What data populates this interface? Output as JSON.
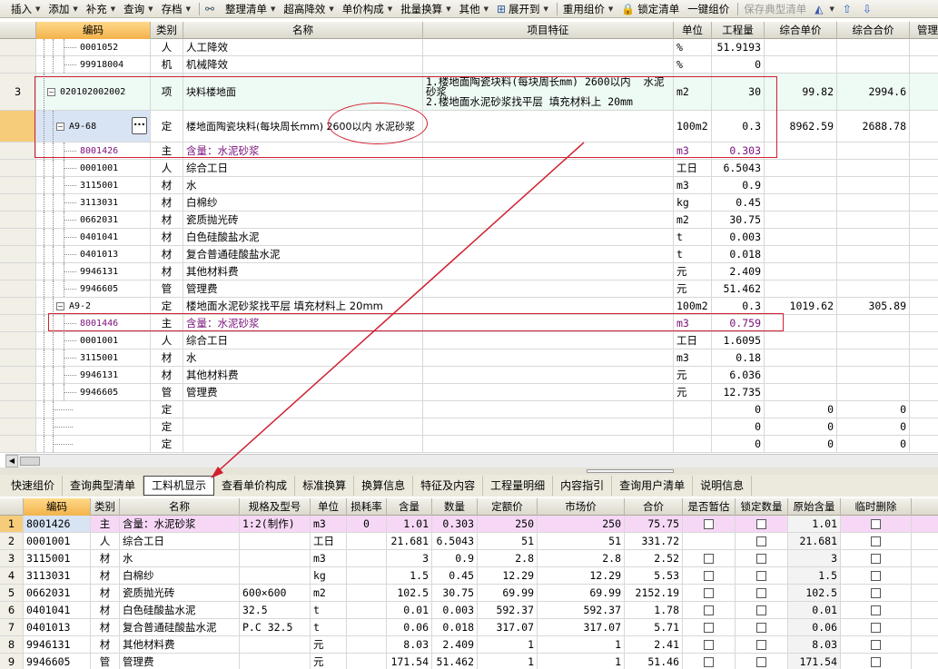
{
  "toolbar": [
    {
      "label": "插入",
      "dd": true
    },
    {
      "label": "添加",
      "dd": true
    },
    {
      "label": "补充",
      "dd": true
    },
    {
      "label": "查询",
      "dd": true
    },
    {
      "label": "存档",
      "dd": true
    },
    {
      "label": "",
      "icon": "binoculars-icon",
      "dd": false
    },
    {
      "label": "整理清单",
      "dd": true
    },
    {
      "label": "超高降效",
      "dd": true
    },
    {
      "label": "单价构成",
      "dd": true
    },
    {
      "label": "批量换算",
      "dd": true
    },
    {
      "label": "其他",
      "dd": true
    },
    {
      "label": "展开到",
      "icon": "tree-icon",
      "dd": true
    },
    {
      "label": "重用组价",
      "dd": true
    },
    {
      "label": "锁定清单",
      "icon": "lock-icon",
      "dd": false
    },
    {
      "label": "一键组价",
      "dd": false
    },
    {
      "label": "保存典型清单",
      "dd": false,
      "disabled": true
    },
    {
      "label": "",
      "icon": "paint-bucket-icon",
      "dd": true
    },
    {
      "label": "",
      "icon": "arrow-up-icon",
      "dd": false
    },
    {
      "label": "",
      "icon": "arrow-down-icon",
      "dd": false
    }
  ],
  "grid1": {
    "headers": [
      "编码",
      "类别",
      "名称",
      "项目特征",
      "单位",
      "工程量",
      "综合单价",
      "综合合价",
      "管理"
    ],
    "rows": [
      {
        "num": "",
        "code": "0001052",
        "type": "人",
        "name": "人工降效",
        "feature": "",
        "unit": "%",
        "qty": "51.9193",
        "uprice": "",
        "total": "",
        "level": 2
      },
      {
        "num": "",
        "code": "99918004",
        "type": "机",
        "name": "机械降效",
        "feature": "",
        "unit": "%",
        "qty": "0",
        "uprice": "",
        "total": "",
        "level": 2
      },
      {
        "num": "3",
        "code": "020102002002",
        "type": "项",
        "name": "块料楼地面",
        "feature": "1.楼地面陶瓷块料(每块周长mm) 2600以内  水泥砂浆\n2.楼地面水泥砂浆找平层 填充材料上 20mm",
        "unit": "m2",
        "qty": "30",
        "uprice": "99.82",
        "total": "2994.6",
        "level": 0,
        "tall": true
      },
      {
        "num": "",
        "code": "A9-68",
        "type": "定",
        "name": "楼地面陶瓷块料(每块周长mm) 2600以内  水泥砂浆",
        "feature": "",
        "unit": "100m2",
        "qty": "0.3",
        "uprice": "8962.59",
        "total": "2688.78",
        "level": 1,
        "tall": true,
        "selected": true
      },
      {
        "num": "",
        "code": "8001426",
        "type": "主",
        "name": "含量：水泥砂浆",
        "feature": "",
        "unit": "m3",
        "qty": "0.303",
        "uprice": "",
        "total": "",
        "level": 2,
        "purple": true
      },
      {
        "num": "",
        "code": "0001001",
        "type": "人",
        "name": "综合工日",
        "feature": "",
        "unit": "工日",
        "qty": "6.5043",
        "uprice": "",
        "total": "",
        "level": 2
      },
      {
        "num": "",
        "code": "3115001",
        "type": "材",
        "name": "水",
        "feature": "",
        "unit": "m3",
        "qty": "0.9",
        "uprice": "",
        "total": "",
        "level": 2
      },
      {
        "num": "",
        "code": "3113031",
        "type": "材",
        "name": "白棉纱",
        "feature": "",
        "unit": "kg",
        "qty": "0.45",
        "uprice": "",
        "total": "",
        "level": 2
      },
      {
        "num": "",
        "code": "0662031",
        "type": "材",
        "name": "瓷质抛光砖",
        "feature": "",
        "unit": "m2",
        "qty": "30.75",
        "uprice": "",
        "total": "",
        "level": 2
      },
      {
        "num": "",
        "code": "0401041",
        "type": "材",
        "name": "白色硅酸盐水泥",
        "feature": "",
        "unit": "t",
        "qty": "0.003",
        "uprice": "",
        "total": "",
        "level": 2
      },
      {
        "num": "",
        "code": "0401013",
        "type": "材",
        "name": "复合普通硅酸盐水泥",
        "feature": "",
        "unit": "t",
        "qty": "0.018",
        "uprice": "",
        "total": "",
        "level": 2
      },
      {
        "num": "",
        "code": "9946131",
        "type": "材",
        "name": "其他材料费",
        "feature": "",
        "unit": "元",
        "qty": "2.409",
        "uprice": "",
        "total": "",
        "level": 2
      },
      {
        "num": "",
        "code": "9946605",
        "type": "管",
        "name": "管理费",
        "feature": "",
        "unit": "元",
        "qty": "51.462",
        "uprice": "",
        "total": "",
        "level": 2
      },
      {
        "num": "",
        "code": "A9-2",
        "type": "定",
        "name": "楼地面水泥砂浆找平层 填充材料上 20mm",
        "feature": "",
        "unit": "100m2",
        "qty": "0.3",
        "uprice": "1019.62",
        "total": "305.89",
        "level": 1
      },
      {
        "num": "",
        "code": "8001446",
        "type": "主",
        "name": "含量：水泥砂浆",
        "feature": "",
        "unit": "m3",
        "qty": "0.759",
        "uprice": "",
        "total": "",
        "level": 2,
        "purple": true
      },
      {
        "num": "",
        "code": "0001001",
        "type": "人",
        "name": "综合工日",
        "feature": "",
        "unit": "工日",
        "qty": "1.6095",
        "uprice": "",
        "total": "",
        "level": 2
      },
      {
        "num": "",
        "code": "3115001",
        "type": "材",
        "name": "水",
        "feature": "",
        "unit": "m3",
        "qty": "0.18",
        "uprice": "",
        "total": "",
        "level": 2
      },
      {
        "num": "",
        "code": "9946131",
        "type": "材",
        "name": "其他材料费",
        "feature": "",
        "unit": "元",
        "qty": "6.036",
        "uprice": "",
        "total": "",
        "level": 2
      },
      {
        "num": "",
        "code": "9946605",
        "type": "管",
        "name": "管理费",
        "feature": "",
        "unit": "元",
        "qty": "12.735",
        "uprice": "",
        "total": "",
        "level": 2
      },
      {
        "num": "",
        "code": "",
        "type": "定",
        "name": "",
        "feature": "",
        "unit": "",
        "qty": "0",
        "uprice": "0",
        "total": "0",
        "level": 1
      },
      {
        "num": "",
        "code": "",
        "type": "定",
        "name": "",
        "feature": "",
        "unit": "",
        "qty": "0",
        "uprice": "0",
        "total": "0",
        "level": 1
      },
      {
        "num": "",
        "code": "",
        "type": "定",
        "name": "",
        "feature": "",
        "unit": "",
        "qty": "0",
        "uprice": "0",
        "total": "0",
        "level": 1
      }
    ]
  },
  "tabs": [
    {
      "label": "快速组价"
    },
    {
      "label": "查询典型清单"
    },
    {
      "label": "工料机显示",
      "active": true
    },
    {
      "label": "查看单价构成"
    },
    {
      "label": "标准换算"
    },
    {
      "label": "换算信息"
    },
    {
      "label": "特征及内容"
    },
    {
      "label": "工程量明细"
    },
    {
      "label": "内容指引"
    },
    {
      "label": "查询用户清单"
    },
    {
      "label": "说明信息"
    }
  ],
  "grid2": {
    "headers": [
      "",
      "编码",
      "类别",
      "名称",
      "规格及型号",
      "单位",
      "损耗率",
      "含量",
      "数量",
      "定额价",
      "市场价",
      "合价",
      "是否暂估",
      "锁定数量",
      "原始含量",
      "临时删除"
    ],
    "rows": [
      {
        "n": "1",
        "code": "8001426",
        "type": "主",
        "name": "含量：水泥砂浆",
        "spec": "1:2(制作)",
        "unit": "m3",
        "loss": "0",
        "content": "1.01",
        "qty": "0.303",
        "quota": "250",
        "market": "250",
        "total": "75.75",
        "est": true,
        "lock": true,
        "orig": "1.01",
        "del": true,
        "highlight": true
      },
      {
        "n": "2",
        "code": "0001001",
        "type": "人",
        "name": "综合工日",
        "spec": "",
        "unit": "工日",
        "loss": "",
        "content": "21.681",
        "qty": "6.5043",
        "quota": "51",
        "market": "51",
        "total": "331.72",
        "est": false,
        "lock": true,
        "orig": "21.681",
        "del": true
      },
      {
        "n": "3",
        "code": "3115001",
        "type": "材",
        "name": "水",
        "spec": "",
        "unit": "m3",
        "loss": "",
        "content": "3",
        "qty": "0.9",
        "quota": "2.8",
        "market": "2.8",
        "total": "2.52",
        "est": true,
        "lock": true,
        "orig": "3",
        "del": true
      },
      {
        "n": "4",
        "code": "3113031",
        "type": "材",
        "name": "白棉纱",
        "spec": "",
        "unit": "kg",
        "loss": "",
        "content": "1.5",
        "qty": "0.45",
        "quota": "12.29",
        "market": "12.29",
        "total": "5.53",
        "est": true,
        "lock": true,
        "orig": "1.5",
        "del": true
      },
      {
        "n": "5",
        "code": "0662031",
        "type": "材",
        "name": "瓷质抛光砖",
        "spec": "600×600",
        "unit": "m2",
        "loss": "",
        "content": "102.5",
        "qty": "30.75",
        "quota": "69.99",
        "market": "69.99",
        "total": "2152.19",
        "est": true,
        "lock": true,
        "orig": "102.5",
        "del": true
      },
      {
        "n": "6",
        "code": "0401041",
        "type": "材",
        "name": "白色硅酸盐水泥",
        "spec": "32.5",
        "unit": "t",
        "loss": "",
        "content": "0.01",
        "qty": "0.003",
        "quota": "592.37",
        "market": "592.37",
        "total": "1.78",
        "est": true,
        "lock": true,
        "orig": "0.01",
        "del": true
      },
      {
        "n": "7",
        "code": "0401013",
        "type": "材",
        "name": "复合普通硅酸盐水泥",
        "spec": "P.C  32.5",
        "unit": "t",
        "loss": "",
        "content": "0.06",
        "qty": "0.018",
        "quota": "317.07",
        "market": "317.07",
        "total": "5.71",
        "est": true,
        "lock": true,
        "orig": "0.06",
        "del": true
      },
      {
        "n": "8",
        "code": "9946131",
        "type": "材",
        "name": "其他材料费",
        "spec": "",
        "unit": "元",
        "loss": "",
        "content": "8.03",
        "qty": "2.409",
        "quota": "1",
        "market": "1",
        "total": "2.41",
        "est": true,
        "lock": true,
        "orig": "8.03",
        "del": true
      },
      {
        "n": "9",
        "code": "9946605",
        "type": "管",
        "name": "管理费",
        "spec": "",
        "unit": "元",
        "loss": "",
        "content": "171.54",
        "qty": "51.462",
        "quota": "1",
        "market": "1",
        "total": "51.46",
        "est": true,
        "lock": true,
        "orig": "171.54",
        "del": true
      }
    ]
  }
}
